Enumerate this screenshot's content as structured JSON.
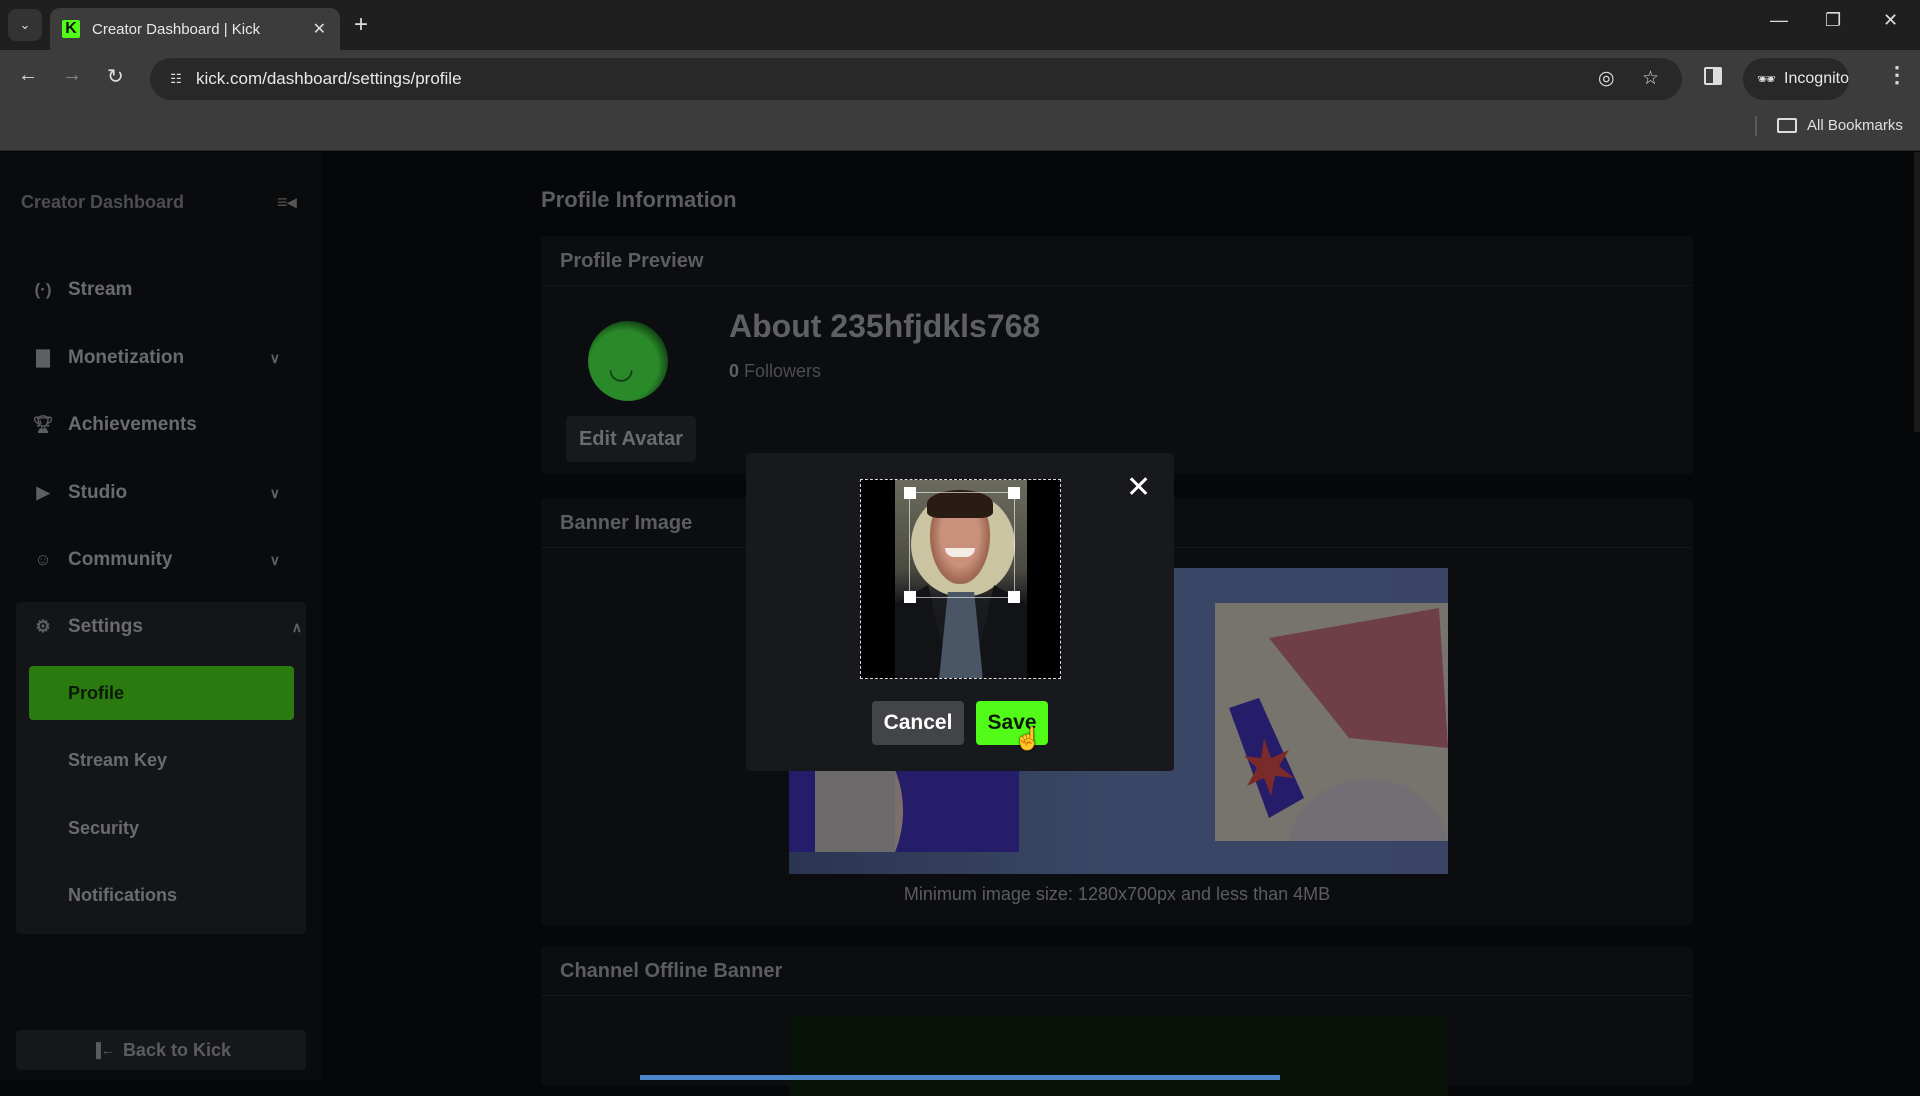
{
  "browser": {
    "tab_title": "Creator Dashboard | Kick",
    "tab_favicon": "K",
    "url": "kick.com/dashboard/settings/profile",
    "incognito_label": "Incognito",
    "bookmarks_label": "All Bookmarks",
    "icons": {
      "tab_list": "chevron-down-icon",
      "close_tab": "close-icon",
      "new_tab": "plus-icon",
      "back": "arrow-left-icon",
      "forward": "arrow-right-icon",
      "reload": "reload-icon",
      "site_info": "tune-icon",
      "tracking_protection": "eye-off-icon",
      "bookmark": "star-icon",
      "side_panel": "side-panel-icon",
      "menu": "kebab-menu-icon",
      "folder": "folder-icon"
    }
  },
  "sidebar": {
    "title": "Creator Dashboard",
    "items": [
      {
        "label": "Stream",
        "icon": "broadcast-icon",
        "has_chevron": false
      },
      {
        "label": "Monetization",
        "icon": "chart-icon",
        "has_chevron": true
      },
      {
        "label": "Achievements",
        "icon": "trophy-icon",
        "has_chevron": false
      },
      {
        "label": "Studio",
        "icon": "video-icon",
        "has_chevron": true
      },
      {
        "label": "Community",
        "icon": "users-icon",
        "has_chevron": true
      },
      {
        "label": "Settings",
        "icon": "gear-icon",
        "has_chevron": true,
        "expanded": true
      }
    ],
    "settings_sub": [
      {
        "label": "Profile",
        "active": true
      },
      {
        "label": "Stream Key",
        "active": false
      },
      {
        "label": "Security",
        "active": false
      },
      {
        "label": "Notifications",
        "active": false
      }
    ],
    "back_label": "Back to Kick"
  },
  "main": {
    "title": "Profile Information",
    "profile_preview": {
      "heading": "Profile Preview",
      "about": "About 235hfjdkls768",
      "followers_count": "0",
      "followers_label": "Followers",
      "edit_avatar_label": "Edit Avatar"
    },
    "banner": {
      "heading": "Banner Image",
      "note": "Minimum image size: 1280x700px and less than 4MB"
    },
    "offline_banner": {
      "heading": "Channel Offline Banner"
    }
  },
  "modal": {
    "cancel_label": "Cancel",
    "save_label": "Save"
  },
  "colors": {
    "accent": "#53fc18",
    "active_nav": "#2b7a10"
  }
}
